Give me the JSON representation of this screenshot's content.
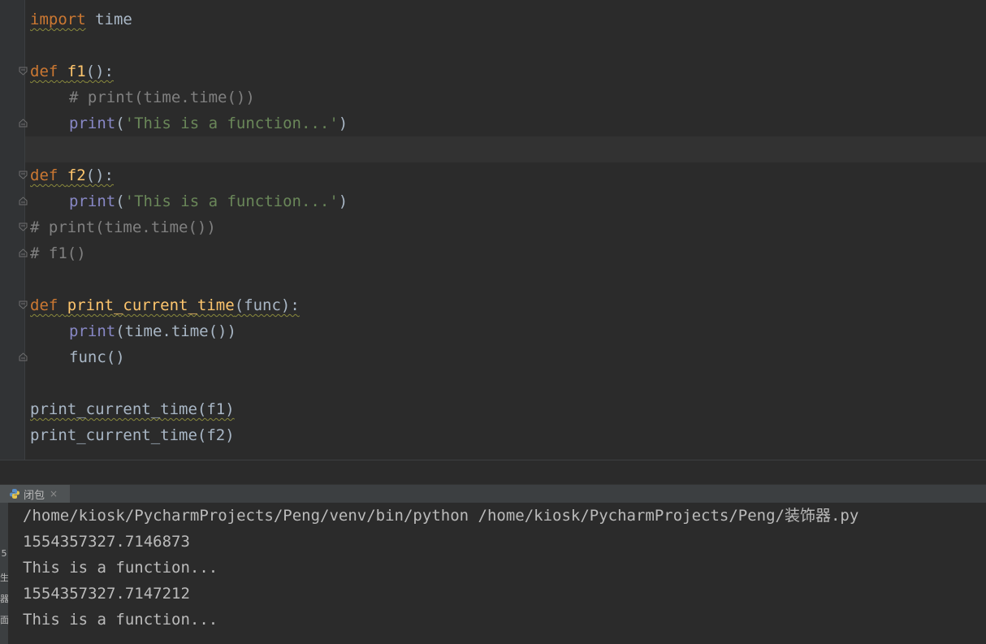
{
  "editor": {
    "line1": {
      "kw": "import",
      "name": "time"
    },
    "line3": {
      "kw": "def",
      "name": "f1",
      "punct": "():"
    },
    "line4": {
      "comment": "# print(time.time())"
    },
    "line5": {
      "fn": "print",
      "open": "(",
      "str": "'This is a function...'",
      "close": ")"
    },
    "line7": {
      "kw": "def",
      "name": "f2",
      "punct": "():"
    },
    "line8": {
      "fn": "print",
      "open": "(",
      "str": "'This is a function...'",
      "close": ")"
    },
    "line9": {
      "comment": "# print(time.time())"
    },
    "line10": {
      "comment": "# f1()"
    },
    "line12": {
      "kw": "def",
      "name": "print_current_time",
      "params": "(func):"
    },
    "line13": {
      "fn": "print",
      "rest": "(time.time())"
    },
    "line14": {
      "text": "func()"
    },
    "line16": {
      "text": "print_current_time(f1)"
    },
    "line17": {
      "text": "print_current_time(f2)"
    }
  },
  "run_panel": {
    "tab_label": "闭包",
    "tab_close": "×",
    "side_glyphs": [
      "5",
      "生",
      "器",
      "面"
    ]
  },
  "console": {
    "lines": [
      "/home/kiosk/PycharmProjects/Peng/venv/bin/python /home/kiosk/PycharmProjects/Peng/装饰器.py",
      "1554357327.7146873",
      "This is a function...",
      "1554357327.7147212",
      "This is a function..."
    ]
  },
  "colors": {
    "background": "#2b2b2b",
    "keyword": "#cc7832",
    "function_name": "#ffc66d",
    "builtin": "#8888c6",
    "string": "#6a8759",
    "comment": "#808080",
    "text": "#a9b7c6"
  }
}
